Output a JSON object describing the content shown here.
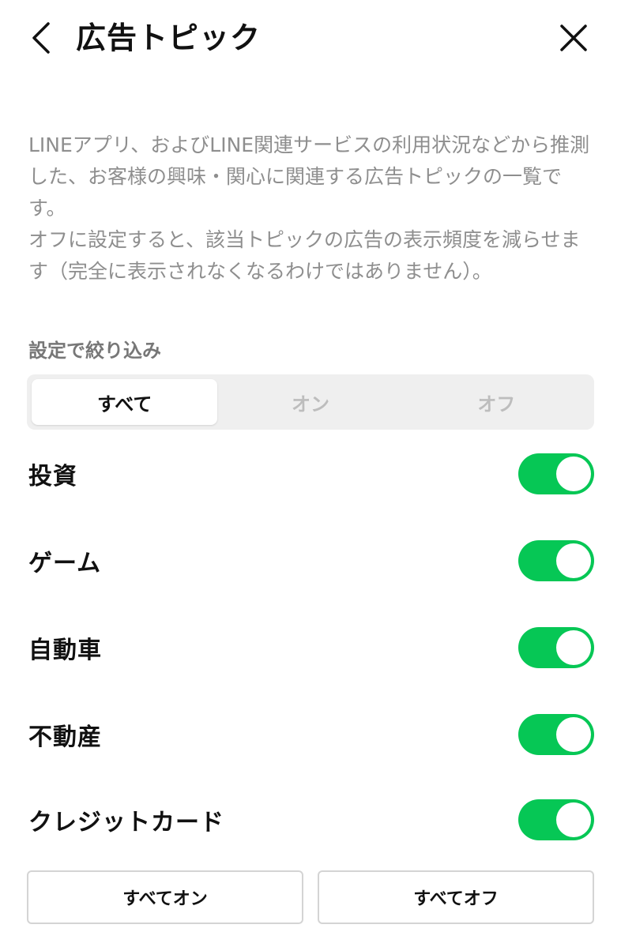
{
  "header": {
    "title": "広告トピック",
    "back_icon": "chevron-left-icon",
    "close_icon": "close-icon"
  },
  "description": {
    "paragraph1": "LINEアプリ、およびLINE関連サービスの利用状況などから推測した、お客様の興味・関心に関連する広告トピックの一覧です。",
    "paragraph2": "オフに設定すると、該当トピックの広告の表示頻度を減らせます（完全に表示されなくなるわけではありません）。"
  },
  "filter": {
    "label": "設定で絞り込み",
    "options": [
      {
        "label": "すべて",
        "selected": true
      },
      {
        "label": "オン",
        "selected": false
      },
      {
        "label": "オフ",
        "selected": false
      }
    ]
  },
  "topics": [
    {
      "label": "投資",
      "enabled": true
    },
    {
      "label": "ゲーム",
      "enabled": true
    },
    {
      "label": "自動車",
      "enabled": true
    },
    {
      "label": "不動産",
      "enabled": true
    },
    {
      "label": "クレジットカード",
      "enabled": true
    }
  ],
  "actions": {
    "all_on": "すべてオン",
    "all_off": "すべてオフ"
  },
  "colors": {
    "toggle_on": "#06c755",
    "description_text": "#8e8e8e",
    "segment_bg": "#efefef"
  }
}
